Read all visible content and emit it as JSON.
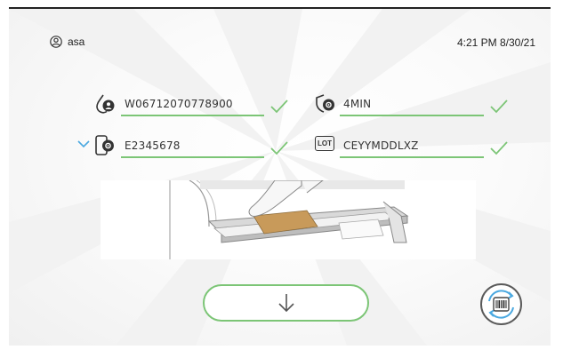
{
  "header": {
    "user_icon": "user-circle-icon",
    "username": "asa",
    "datetime": "4:21 PM 8/30/21"
  },
  "fields": {
    "barcode": {
      "icon": "drop-user-icon",
      "value": "W06712070778900",
      "valid": true
    },
    "time": {
      "icon": "shield-gear-icon",
      "value": "4MIN",
      "valid": true
    },
    "device": {
      "icon": "phone-gear-icon",
      "value": "E2345678",
      "valid": true,
      "expander_icon": "chevron-down-icon"
    },
    "lot": {
      "icon": "lot-icon",
      "icon_text": "LOT",
      "value": "CEYYMDDLXZ",
      "valid": true
    }
  },
  "illustration": {
    "name": "insert-bag-into-tray-illustration"
  },
  "actions": {
    "proceed_icon": "arrow-down-icon",
    "scan_icon": "barcode-rescan-icon"
  },
  "colors": {
    "accent_green": "#7cc576",
    "chevron_blue": "#4aa8e0",
    "text": "#333333"
  }
}
